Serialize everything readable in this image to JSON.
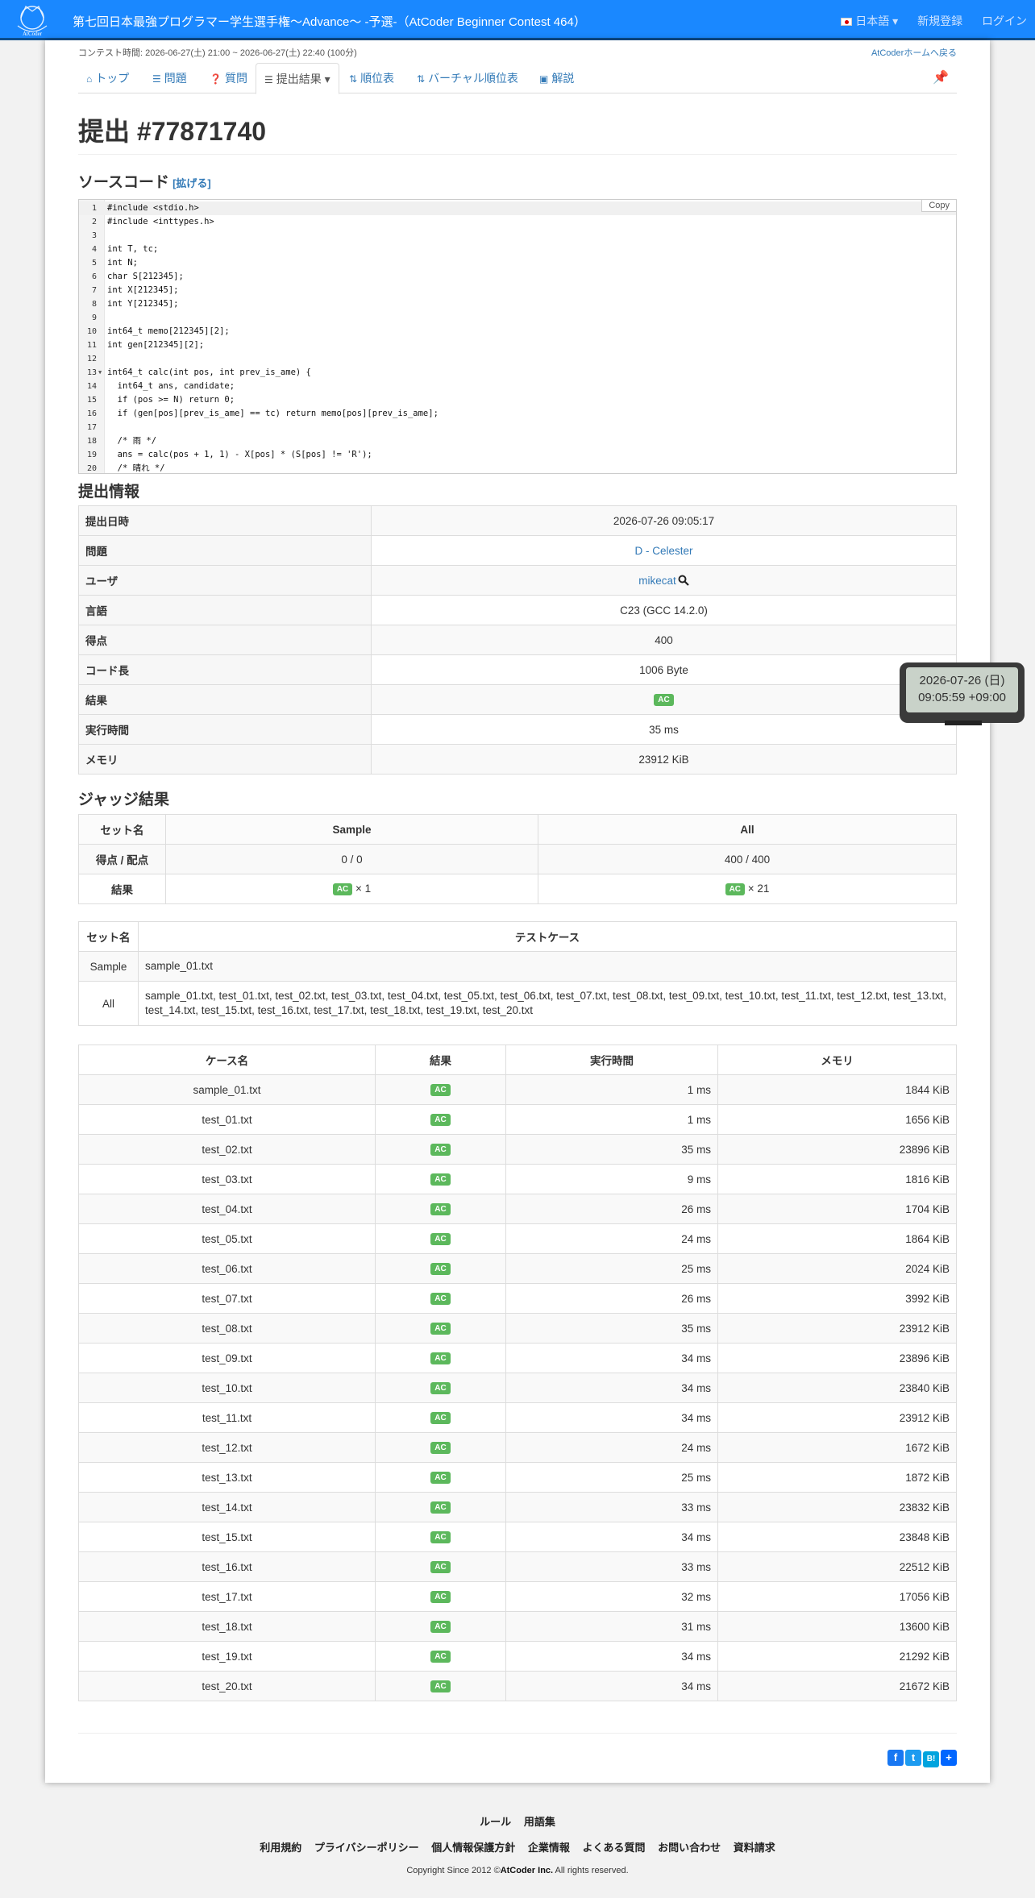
{
  "header": {
    "logo_text": "AtCoder",
    "contest_title": "第七回日本最強プログラマー学生選手権〜Advance〜 -予選-（AtCoder Beginner Contest 464）",
    "language": "日本語",
    "register": "新規登録",
    "login": "ログイン"
  },
  "contest": {
    "time": "コンテスト時間: 2026-06-27(土) 21:00 ~ 2026-06-27(土) 22:40 (100分)",
    "home_link": "AtCoderホームへ戻る"
  },
  "tabs": [
    {
      "label": "トップ",
      "icon": "home-icon"
    },
    {
      "label": "問題",
      "icon": "list-icon"
    },
    {
      "label": "質問",
      "icon": "question-icon"
    },
    {
      "label": "提出結果",
      "icon": "list-icon"
    },
    {
      "label": "順位表",
      "icon": "sort-icon"
    },
    {
      "label": "バーチャル順位表",
      "icon": "sort-icon"
    },
    {
      "label": "解説",
      "icon": "book-icon"
    }
  ],
  "page_title": "提出 #77871740",
  "source": {
    "heading": "ソースコード",
    "expand": "[拡げる]",
    "copy": "Copy",
    "lines": [
      "#include <stdio.h>",
      "#include <inttypes.h>",
      "",
      "int T, tc;",
      "int N;",
      "char S[212345];",
      "int X[212345];",
      "int Y[212345];",
      "",
      "int64_t memo[212345][2];",
      "int gen[212345][2];",
      "",
      "int64_t calc(int pos, int prev_is_ame) {",
      "  int64_t ans, candidate;",
      "  if (pos >= N) return 0;",
      "  if (gen[pos][prev_is_ame] == tc) return memo[pos][prev_is_ame];",
      "",
      "  /* 雨 */",
      "  ans = calc(pos + 1, 1) - X[pos] * (S[pos] != 'R');",
      "  /* 晴れ */"
    ]
  },
  "submission_info": {
    "heading": "提出情報",
    "rows": [
      {
        "label": "提出日時",
        "value": "2026-07-26 09:05:17"
      },
      {
        "label": "問題",
        "value": "D - Celester"
      },
      {
        "label": "ユーザ",
        "value": "mikecat"
      },
      {
        "label": "言語",
        "value": "C23 (GCC 14.2.0)"
      },
      {
        "label": "得点",
        "value": "400"
      },
      {
        "label": "コード長",
        "value": "1006 Byte"
      },
      {
        "label": "結果",
        "value": "AC"
      },
      {
        "label": "実行時間",
        "value": "35 ms"
      },
      {
        "label": "メモリ",
        "value": "23912 KiB"
      }
    ]
  },
  "judge": {
    "heading": "ジャッジ結果",
    "col_set": "セット名",
    "col_sample": "Sample",
    "col_all": "All",
    "row_score": "得点 / 配点",
    "sample_score": "0 / 0",
    "all_score": "400 / 400",
    "row_result": "結果",
    "sample_result_badge": "AC",
    "sample_result_count": "× 1",
    "all_result_badge": "AC",
    "all_result_count": "× 21"
  },
  "sets": {
    "col_set": "セット名",
    "col_cases": "テストケース",
    "rows": [
      {
        "name": "Sample",
        "cases": "sample_01.txt"
      },
      {
        "name": "All",
        "cases": "sample_01.txt, test_01.txt, test_02.txt, test_03.txt, test_04.txt, test_05.txt, test_06.txt, test_07.txt, test_08.txt, test_09.txt, test_10.txt, test_11.txt, test_12.txt, test_13.txt, test_14.txt, test_15.txt, test_16.txt, test_17.txt, test_18.txt, test_19.txt, test_20.txt"
      }
    ]
  },
  "cases": {
    "headers": [
      "ケース名",
      "結果",
      "実行時間",
      "メモリ"
    ],
    "rows": [
      {
        "name": "sample_01.txt",
        "result": "AC",
        "time": "1 ms",
        "memory": "1844 KiB"
      },
      {
        "name": "test_01.txt",
        "result": "AC",
        "time": "1 ms",
        "memory": "1656 KiB"
      },
      {
        "name": "test_02.txt",
        "result": "AC",
        "time": "35 ms",
        "memory": "23896 KiB"
      },
      {
        "name": "test_03.txt",
        "result": "AC",
        "time": "9 ms",
        "memory": "1816 KiB"
      },
      {
        "name": "test_04.txt",
        "result": "AC",
        "time": "26 ms",
        "memory": "1704 KiB"
      },
      {
        "name": "test_05.txt",
        "result": "AC",
        "time": "24 ms",
        "memory": "1864 KiB"
      },
      {
        "name": "test_06.txt",
        "result": "AC",
        "time": "25 ms",
        "memory": "2024 KiB"
      },
      {
        "name": "test_07.txt",
        "result": "AC",
        "time": "26 ms",
        "memory": "3992 KiB"
      },
      {
        "name": "test_08.txt",
        "result": "AC",
        "time": "35 ms",
        "memory": "23912 KiB"
      },
      {
        "name": "test_09.txt",
        "result": "AC",
        "time": "34 ms",
        "memory": "23896 KiB"
      },
      {
        "name": "test_10.txt",
        "result": "AC",
        "time": "34 ms",
        "memory": "23840 KiB"
      },
      {
        "name": "test_11.txt",
        "result": "AC",
        "time": "34 ms",
        "memory": "23912 KiB"
      },
      {
        "name": "test_12.txt",
        "result": "AC",
        "time": "24 ms",
        "memory": "1672 KiB"
      },
      {
        "name": "test_13.txt",
        "result": "AC",
        "time": "25 ms",
        "memory": "1872 KiB"
      },
      {
        "name": "test_14.txt",
        "result": "AC",
        "time": "33 ms",
        "memory": "23832 KiB"
      },
      {
        "name": "test_15.txt",
        "result": "AC",
        "time": "34 ms",
        "memory": "23848 KiB"
      },
      {
        "name": "test_16.txt",
        "result": "AC",
        "time": "33 ms",
        "memory": "22512 KiB"
      },
      {
        "name": "test_17.txt",
        "result": "AC",
        "time": "32 ms",
        "memory": "17056 KiB"
      },
      {
        "name": "test_18.txt",
        "result": "AC",
        "time": "31 ms",
        "memory": "13600 KiB"
      },
      {
        "name": "test_19.txt",
        "result": "AC",
        "time": "34 ms",
        "memory": "21292 KiB"
      },
      {
        "name": "test_20.txt",
        "result": "AC",
        "time": "34 ms",
        "memory": "21672 KiB"
      }
    ]
  },
  "share_icons": [
    "f",
    "t",
    "B!",
    "+"
  ],
  "clock": {
    "date": "2026-07-26 (日)",
    "time": "09:05:59 +09:00"
  },
  "footer": {
    "row1": [
      "ルール",
      "用語集"
    ],
    "row2": [
      "利用規約",
      "プライバシーポリシー",
      "個人情報保護方針",
      "企業情報",
      "よくある質問",
      "お問い合わせ",
      "資料請求"
    ],
    "copyright_prefix": "Copyright Since 2012 ©",
    "copyright_company": "AtCoder Inc.",
    "copyright_suffix": " All rights reserved."
  },
  "colors": {
    "navbar": "#1a88ff",
    "link": "#337ab7",
    "ac_badge": "#5cb85c"
  }
}
